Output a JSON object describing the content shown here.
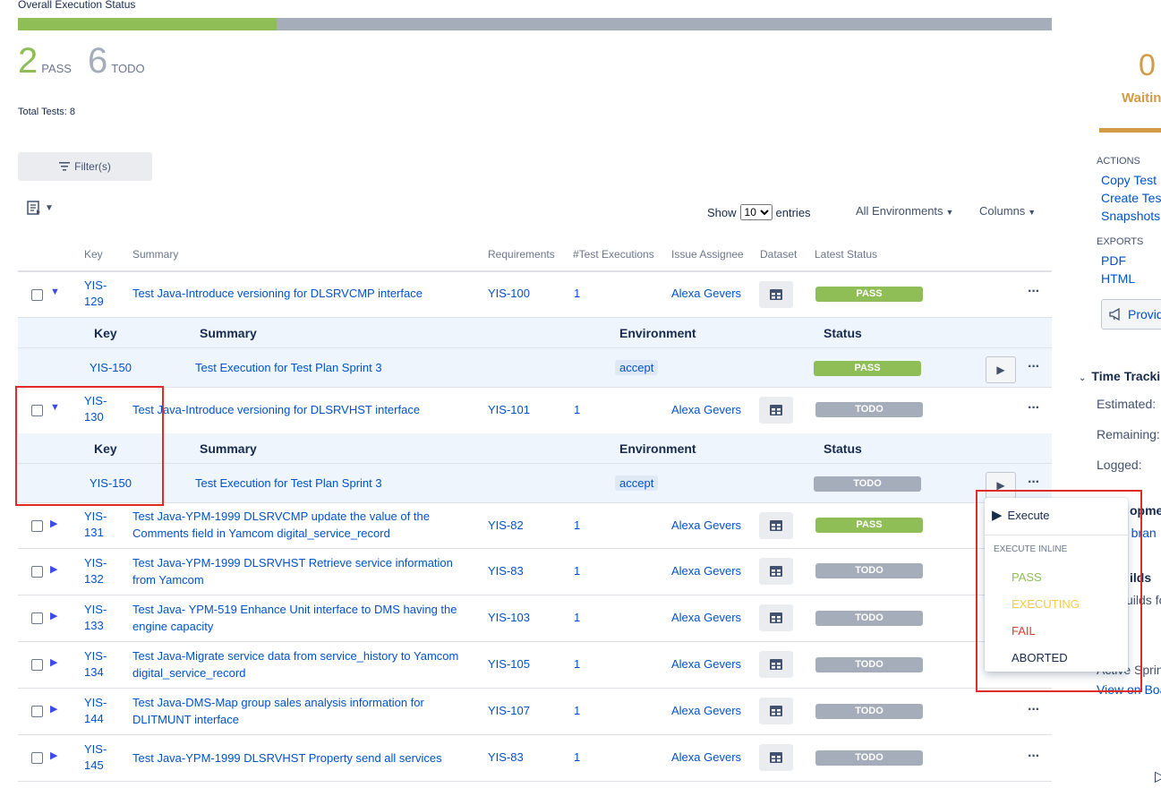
{
  "header": {
    "title": "Overall Execution Status",
    "progress_pass_fraction": 0.25,
    "pass_count": "2",
    "pass_label": "PASS",
    "todo_count": "6",
    "todo_label": "TODO",
    "total_tests": "Total Tests: 8"
  },
  "toolbar": {
    "filter_label": "Filter(s)",
    "show_label": "Show",
    "entries_value": "10",
    "entries_options": [
      "10"
    ],
    "entries_label": "entries",
    "environments_label": "All Environments",
    "columns_label": "Columns"
  },
  "table": {
    "headers": {
      "key": "Key",
      "summary": "Summary",
      "requirements": "Requirements",
      "executions": "#Test Executions",
      "assignee": "Issue Assignee",
      "dataset": "Dataset",
      "latest_status": "Latest Status"
    },
    "rows": [
      {
        "key": "YIS-\n129",
        "summary": "Test Java-Introduce versioning for DLSRVCMP interface",
        "requirement": "YIS-100",
        "executions": "1",
        "assignee": "Alexa Gevers",
        "status": "PASS"
      },
      {
        "key": "YIS-\n130",
        "summary": "Test Java-Introduce versioning for DLSRVHST interface",
        "requirement": "YIS-101",
        "executions": "1",
        "assignee": "Alexa Gevers",
        "status": "TODO"
      },
      {
        "key": "YIS-\n131",
        "summary": "Test Java-YPM-1999 DLSRVCMP update the value of the Comments field in Yamcom digital_service_record",
        "requirement": "YIS-82",
        "executions": "1",
        "assignee": "Alexa Gevers",
        "status": "PASS"
      },
      {
        "key": "YIS-\n132",
        "summary": "Test Java-YPM-1999 DLSRVHST Retrieve service information from Yamcom",
        "requirement": "YIS-83",
        "executions": "1",
        "assignee": "Alexa Gevers",
        "status": "TODO"
      },
      {
        "key": "YIS-\n133",
        "summary": "Test Java- YPM-519 Enhance Unit interface to DMS having the engine capacity",
        "requirement": "YIS-103",
        "executions": "1",
        "assignee": "Alexa Gevers",
        "status": "TODO"
      },
      {
        "key": "YIS-\n134",
        "summary": "Test Java-Migrate service data from service_history to Yamcom digital_service_record",
        "requirement": "YIS-105",
        "executions": "1",
        "assignee": "Alexa Gevers",
        "status": "TODO"
      },
      {
        "key": "YIS-\n144",
        "summary": "Test Java-DMS-Map group sales analysis information for DLITMUNT interface",
        "requirement": "YIS-107",
        "executions": "1",
        "assignee": "Alexa Gevers",
        "status": "TODO"
      },
      {
        "key": "YIS-\n145",
        "summary": "Test Java-YPM-1999 DLSRVHST Property send all services",
        "requirement": "YIS-83",
        "executions": "1",
        "assignee": "Alexa Gevers",
        "status": "TODO"
      }
    ],
    "sub_headers": {
      "key": "Key",
      "summary": "Summary",
      "environment": "Environment",
      "status": "Status"
    },
    "sub_rows": [
      {
        "key": "YIS-150",
        "summary": "Test Execution for Test Plan Sprint 3",
        "environment": "accept",
        "status": "PASS"
      },
      {
        "key": "YIS-150",
        "summary": "Test Execution for Test Plan Sprint 3",
        "environment": "accept",
        "status": "TODO"
      }
    ]
  },
  "menu": {
    "execute": "Execute",
    "inline_header": "EXECUTE INLINE",
    "items": [
      {
        "label": "PASS",
        "color": "#8fbe57"
      },
      {
        "label": "EXECUTING",
        "color": "#f2c94c"
      },
      {
        "label": "FAIL",
        "color": "#d04437"
      },
      {
        "label": "ABORTED",
        "color": "#172b4d"
      }
    ]
  },
  "sidebar": {
    "waiting_count": "0",
    "waiting_label": "Waitin",
    "actions_header": "ACTIONS",
    "actions": [
      "Copy Test P",
      "Create Test",
      "Snapshots"
    ],
    "exports_header": "EXPORTS",
    "exports": [
      "PDF",
      "HTML"
    ],
    "provide_label": "Provid",
    "time_tracking": "Time Tracki",
    "estimated": "Estimated:",
    "remaining": "Remaining:",
    "logged": "Logged:",
    "fragments": [
      "opme",
      "e bran",
      "ilds",
      "uilds fo",
      "Active Sprin",
      "View on Boa"
    ]
  },
  "colors": {
    "pass": "#8fbe57",
    "todo": "#a5adba",
    "link": "#0052cc",
    "waiting": "#d29b44",
    "highlight": "#e02b2b"
  }
}
